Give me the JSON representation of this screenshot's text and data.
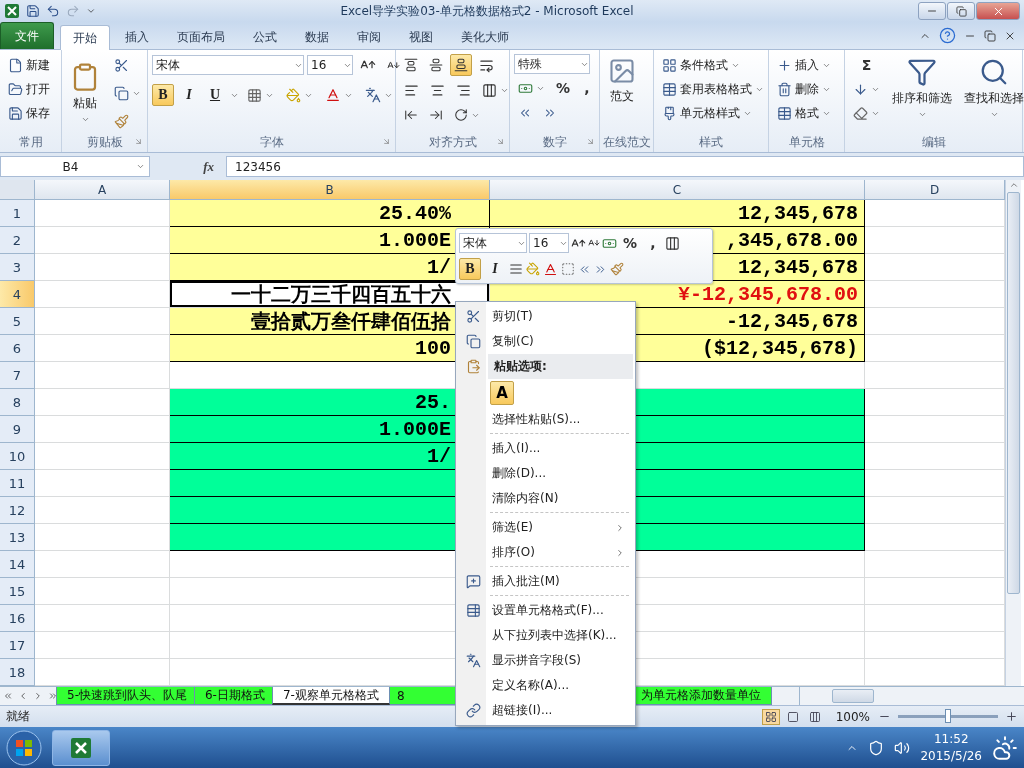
{
  "window": {
    "title": "Excel导学实验03-单元格数据格式2 - Microsoft Excel"
  },
  "ribbon_tabs": [
    {
      "label": "文件",
      "kind": "file",
      "selected": false
    },
    {
      "label": "开始",
      "kind": "tab",
      "selected": true
    },
    {
      "label": "插入",
      "kind": "tab",
      "selected": false
    },
    {
      "label": "页面布局",
      "kind": "tab",
      "selected": false
    },
    {
      "label": "公式",
      "kind": "tab",
      "selected": false
    },
    {
      "label": "数据",
      "kind": "tab",
      "selected": false
    },
    {
      "label": "审阅",
      "kind": "tab",
      "selected": false
    },
    {
      "label": "视图",
      "kind": "tab",
      "selected": false
    },
    {
      "label": "美化大师",
      "kind": "tab",
      "selected": false
    }
  ],
  "ribbon": {
    "groups": [
      {
        "kind": "common",
        "label": "常用",
        "buttons": [
          {
            "kind": "new",
            "label": "新建"
          },
          {
            "kind": "open",
            "label": "打开"
          },
          {
            "kind": "save",
            "label": "保存"
          }
        ]
      },
      {
        "kind": "clipboard",
        "label": "剪贴板",
        "paste": "粘贴"
      },
      {
        "kind": "font",
        "label": "字体",
        "font": "宋体",
        "size": "16",
        "toggles": [
          {
            "kind": "bold",
            "label": "B",
            "on": true
          },
          {
            "kind": "italic",
            "label": "I",
            "on": false
          },
          {
            "kind": "underline",
            "label": "U",
            "on": false
          }
        ]
      },
      {
        "kind": "alignment",
        "label": "对齐方式",
        "toggles": [
          {
            "kind": "top",
            "on": false
          },
          {
            "kind": "middle",
            "on": false
          },
          {
            "kind": "bottom",
            "on": true
          }
        ]
      },
      {
        "kind": "number",
        "label": "数字",
        "format": "特殊",
        "percent": "%",
        "comma": ","
      },
      {
        "kind": "online",
        "label": "在线范文",
        "button": "范文"
      },
      {
        "kind": "styles",
        "label": "样式",
        "buttons": [
          "条件格式",
          "套用表格格式",
          "单元格样式"
        ]
      },
      {
        "kind": "cells",
        "label": "单元格",
        "buttons": [
          "插入",
          "删除",
          "格式"
        ]
      },
      {
        "kind": "editing",
        "label": "编辑",
        "sum": "Σ",
        "buttons": [
          "排序和筛选",
          "查找和选择"
        ]
      }
    ]
  },
  "formula_bar": {
    "name_box": "B4",
    "fx": "fx",
    "value": "123456"
  },
  "grid": {
    "columns": [
      {
        "label": "A",
        "selected": false
      },
      {
        "label": "B",
        "selected": true
      },
      {
        "label": "C",
        "selected": false
      },
      {
        "label": "D",
        "selected": false
      }
    ],
    "rows": [
      {
        "label": "1",
        "selected": false,
        "cells": [
          {
            "selected": false
          },
          {
            "text": "25.40%",
            "color": "#ffff99",
            "alert": false,
            "selected": false
          },
          {
            "text": "12,345,678",
            "color": "#ffff99",
            "alert": false,
            "selected": false
          },
          {
            "selected": false
          }
        ]
      },
      {
        "label": "2",
        "selected": false,
        "cells": [
          {
            "selected": false
          },
          {
            "text": "1.000E",
            "color": "#ffff99",
            "alert": false,
            "selected": false
          },
          {
            "text": ",345,678.00",
            "color": "#ffff99",
            "alert": false,
            "selected": false
          },
          {
            "selected": false
          }
        ]
      },
      {
        "label": "3",
        "selected": false,
        "cells": [
          {
            "selected": false
          },
          {
            "text": "1/",
            "color": "#ffff99",
            "alert": false,
            "selected": false
          },
          {
            "text": "12,345,678",
            "color": "#ffff99",
            "alert": false,
            "selected": false
          },
          {
            "selected": false
          }
        ]
      },
      {
        "label": "4",
        "selected": true,
        "cells": [
          {
            "selected": false
          },
          {
            "text": "一十二万三千四百五十六",
            "alert": false,
            "selected": true
          },
          {
            "text": "¥-12,345,678.00",
            "color": "#ffff99",
            "alert": true,
            "selected": false
          },
          {
            "selected": false
          }
        ]
      },
      {
        "label": "5",
        "selected": false,
        "cells": [
          {
            "selected": false
          },
          {
            "text": "壹拾贰万叁仟肆佰伍拾",
            "color": "#ffff99",
            "alert": false,
            "selected": false
          },
          {
            "text": "-12,345,678",
            "color": "#ffff99",
            "alert": false,
            "selected": false
          },
          {
            "selected": false
          }
        ]
      },
      {
        "label": "6",
        "selected": false,
        "cells": [
          {
            "selected": false
          },
          {
            "text": "100",
            "color": "#ffff99",
            "alert": false,
            "selected": false
          },
          {
            "text": "($12,345,678)",
            "color": "#ffff99",
            "alert": false,
            "selected": false
          },
          {
            "selected": false
          }
        ]
      },
      {
        "label": "7",
        "selected": false,
        "cells": [
          {
            "selected": false
          },
          {
            "selected": false
          },
          {
            "selected": false
          },
          {
            "selected": false
          }
        ]
      },
      {
        "label": "8",
        "selected": false,
        "cells": [
          {
            "selected": false
          },
          {
            "text": "25.",
            "color": "#00ff99",
            "alert": false,
            "selected": false
          },
          {
            "color": "#00ff99",
            "selected": false
          },
          {
            "selected": false
          }
        ]
      },
      {
        "label": "9",
        "selected": false,
        "cells": [
          {
            "selected": false
          },
          {
            "text": "1.000E",
            "color": "#00ff99",
            "alert": false,
            "selected": false
          },
          {
            "color": "#00ff99",
            "selected": false
          },
          {
            "selected": false
          }
        ]
      },
      {
        "label": "10",
        "selected": false,
        "cells": [
          {
            "selected": false
          },
          {
            "text": "1/",
            "color": "#00ff99",
            "alert": false,
            "selected": false
          },
          {
            "color": "#00ff99",
            "selected": false
          },
          {
            "selected": false
          }
        ]
      },
      {
        "label": "11",
        "selected": false,
        "cells": [
          {
            "selected": false
          },
          {
            "color": "#00ff99",
            "selected": false
          },
          {
            "color": "#00ff99",
            "selected": false
          },
          {
            "selected": false
          }
        ]
      },
      {
        "label": "12",
        "selected": false,
        "cells": [
          {
            "selected": false
          },
          {
            "color": "#00ff99",
            "selected": false
          },
          {
            "color": "#00ff99",
            "selected": false
          },
          {
            "selected": false
          }
        ]
      },
      {
        "label": "13",
        "selected": false,
        "cells": [
          {
            "selected": false
          },
          {
            "color": "#00ff99",
            "selected": false
          },
          {
            "color": "#00ff99",
            "selected": false
          },
          {
            "selected": false
          }
        ]
      },
      {
        "label": "14",
        "selected": false,
        "cells": [
          {
            "selected": false
          },
          {
            "selected": false
          },
          {
            "selected": false
          },
          {
            "selected": false
          }
        ]
      },
      {
        "label": "15",
        "selected": false,
        "cells": [
          {
            "selected": false
          },
          {
            "selected": false
          },
          {
            "selected": false
          },
          {
            "selected": false
          }
        ]
      },
      {
        "label": "16",
        "selected": false,
        "cells": [
          {
            "selected": false
          },
          {
            "selected": false
          },
          {
            "selected": false
          },
          {
            "selected": false
          }
        ]
      },
      {
        "label": "17",
        "selected": false,
        "cells": [
          {
            "selected": false
          },
          {
            "selected": false
          },
          {
            "selected": false
          },
          {
            "selected": false
          }
        ]
      },
      {
        "label": "18",
        "selected": false,
        "cells": [
          {
            "selected": false
          },
          {
            "selected": false
          },
          {
            "selected": false
          },
          {
            "selected": false
          }
        ]
      }
    ]
  },
  "mini_toolbar": {
    "font": "宋体",
    "size": "16",
    "percent": "%",
    "comma": ",",
    "toggles": [
      {
        "kind": "bold",
        "label": "B",
        "on": true
      },
      {
        "kind": "italic",
        "label": "I",
        "on": false
      }
    ]
  },
  "context_menu": {
    "items": [
      {
        "kind": "cut",
        "label": "剪切(T)"
      },
      {
        "kind": "copy",
        "label": "复制(C)"
      },
      {
        "kind": "header",
        "label": "粘贴选项:"
      },
      {
        "kind": "paste_option",
        "label": "A"
      },
      {
        "kind": "item",
        "label": "选择性粘贴(S)..."
      },
      {
        "kind": "separator"
      },
      {
        "kind": "item",
        "label": "插入(I)..."
      },
      {
        "kind": "item",
        "label": "删除(D)..."
      },
      {
        "kind": "item",
        "label": "清除内容(N)"
      },
      {
        "kind": "separator"
      },
      {
        "kind": "submenu",
        "label": "筛选(E)"
      },
      {
        "kind": "submenu",
        "label": "排序(O)"
      },
      {
        "kind": "separator"
      },
      {
        "kind": "comment",
        "label": "插入批注(M)"
      },
      {
        "kind": "separator"
      },
      {
        "kind": "format",
        "label": "设置单元格格式(F)..."
      },
      {
        "kind": "item",
        "label": "从下拉列表中选择(K)..."
      },
      {
        "kind": "phonetic",
        "label": "显示拼音字段(S)"
      },
      {
        "kind": "item",
        "label": "定义名称(A)..."
      },
      {
        "kind": "link",
        "label": "超链接(I)..."
      }
    ]
  },
  "sheet_tabs": [
    {
      "label": "5-快速跳到队头、队尾",
      "selected": false,
      "color": "#33ff33"
    },
    {
      "label": "6-日期格式",
      "selected": false,
      "color": "#33ff33"
    },
    {
      "label": "7-观察单元格格式",
      "selected": true,
      "color": "#ffffff"
    },
    {
      "label": "8",
      "selected": false,
      "color": "#33ff33"
    },
    {
      "label": "为单元格添加数量单位",
      "selected": false,
      "color": "#33ff33"
    }
  ],
  "status_bar": {
    "text": "就绪",
    "views": [
      {
        "kind": "normal",
        "selected": true
      },
      {
        "kind": "layout",
        "selected": false
      },
      {
        "kind": "pagebreak",
        "selected": false
      }
    ],
    "zoom": {
      "label": "100%",
      "level": 0.5
    }
  },
  "taskbar": {
    "time": "11:52",
    "date": "2015/5/26"
  }
}
